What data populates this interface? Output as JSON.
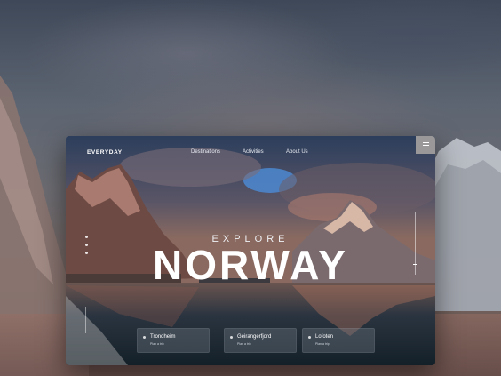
{
  "brand": "EVERYDAY",
  "nav": {
    "links": [
      "Destinations",
      "Activities",
      "About Us"
    ]
  },
  "hero": {
    "kicker": "EXPLORE",
    "title": "NORWAY"
  },
  "destinations": [
    {
      "name": "Trondheim",
      "sub": "Plan a trip"
    },
    {
      "name": "Geirangerfjord",
      "sub": "Plan a trip"
    },
    {
      "name": "Lofoten",
      "sub": "Plan a trip"
    }
  ],
  "icons": [
    "menu-icon"
  ]
}
